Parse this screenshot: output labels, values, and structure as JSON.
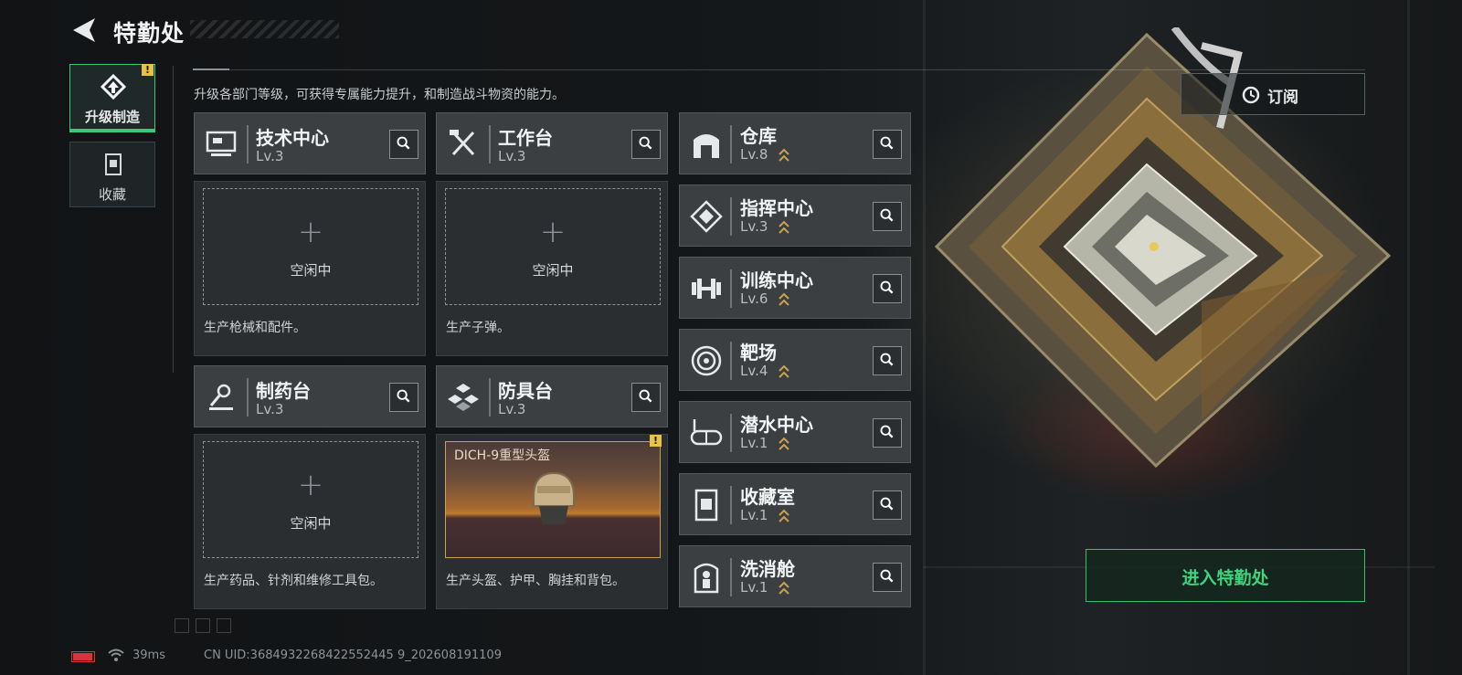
{
  "header": {
    "title": "特勤处"
  },
  "nav": [
    {
      "label": "升级制造",
      "icon": "upgrade-icon",
      "active": true,
      "alert": "!"
    },
    {
      "label": "收藏",
      "icon": "collection-icon",
      "active": false
    }
  ],
  "description": "升级各部门等级，可获得专属能力提升，和制造战斗物资的能力。",
  "workshops": [
    {
      "name": "技术中心",
      "level": "Lv.3",
      "icon": "tech-center-icon",
      "slot_state": "空闲中",
      "caption": "生产枪械和配件。"
    },
    {
      "name": "工作台",
      "level": "Lv.3",
      "icon": "workbench-icon",
      "slot_state": "空闲中",
      "caption": "生产子弹。"
    },
    {
      "name": "制药台",
      "level": "Lv.3",
      "icon": "pharmacy-icon",
      "slot_state": "空闲中",
      "caption": "生产药品、针剂和维修工具包。"
    },
    {
      "name": "防具台",
      "level": "Lv.3",
      "icon": "armor-bench-icon",
      "product_name": "DICH-9重型头盔",
      "alert": "!",
      "caption": "生产头盔、护甲、胸挂和背包。"
    }
  ],
  "departments": [
    {
      "name": "仓库",
      "level": "Lv.8",
      "icon": "warehouse-icon"
    },
    {
      "name": "指挥中心",
      "level": "Lv.3",
      "icon": "command-center-icon"
    },
    {
      "name": "训练中心",
      "level": "Lv.6",
      "icon": "training-center-icon"
    },
    {
      "name": "靶场",
      "level": "Lv.4",
      "icon": "shooting-range-icon"
    },
    {
      "name": "潜水中心",
      "level": "Lv.1",
      "icon": "diving-center-icon"
    },
    {
      "name": "收藏室",
      "level": "Lv.1",
      "icon": "collection-room-icon"
    },
    {
      "name": "洗消舱",
      "level": "Lv.1",
      "icon": "decontamination-icon"
    }
  ],
  "subscribe_label": "订阅",
  "enter_label": "进入特勤处",
  "footer": {
    "ping": "39ms",
    "uid": "CN UID:3684932268422552445 9_202608191109"
  },
  "colors": {
    "accent": "#39c879",
    "warning": "#e8c244",
    "battery": "#d8343a"
  }
}
